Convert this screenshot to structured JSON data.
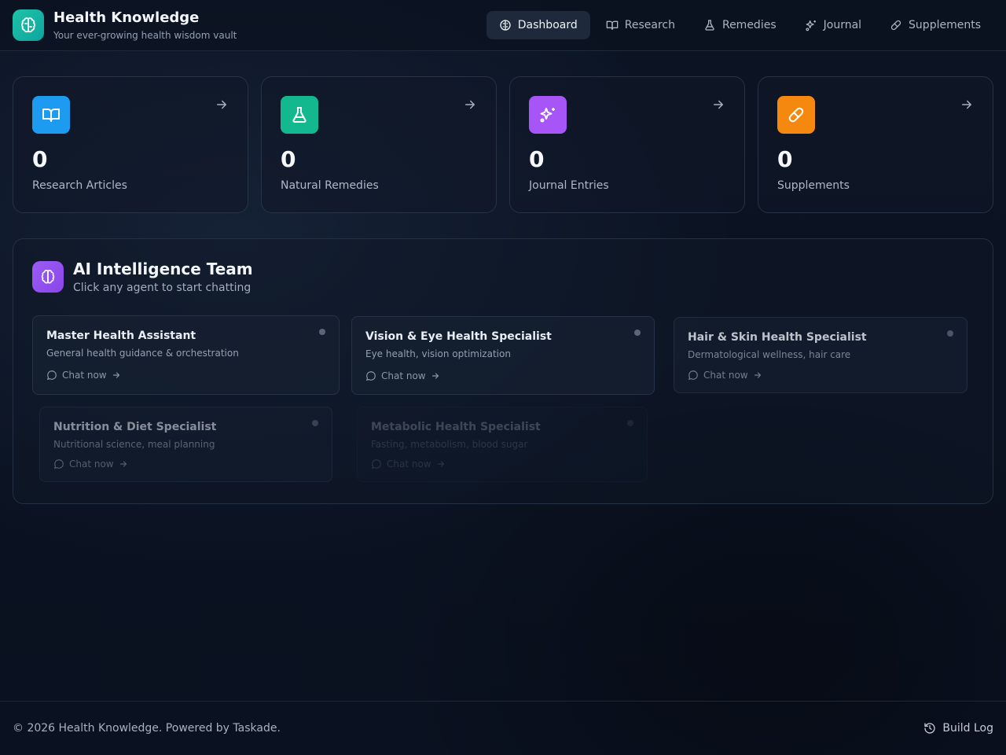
{
  "app": {
    "title": "Health Knowledge",
    "subtitle": "Your ever-growing health wisdom vault",
    "logo_icon": "brain-icon",
    "accent": "#14b8a6"
  },
  "nav": {
    "items": [
      {
        "label": "Dashboard",
        "icon": "brain-icon",
        "active": true
      },
      {
        "label": "Research",
        "icon": "book-open-icon",
        "active": false
      },
      {
        "label": "Remedies",
        "icon": "flask-icon",
        "active": false
      },
      {
        "label": "Journal",
        "icon": "sparkles-icon",
        "active": false
      },
      {
        "label": "Supplements",
        "icon": "pill-icon",
        "active": false
      }
    ]
  },
  "stats": [
    {
      "value": "0",
      "label": "Research Articles",
      "icon": "book-open-icon",
      "color": "#1d9bf0"
    },
    {
      "value": "0",
      "label": "Natural Remedies",
      "icon": "flask-icon",
      "color": "#14b88f"
    },
    {
      "value": "0",
      "label": "Journal Entries",
      "icon": "sparkles-icon",
      "color": "#a855f7"
    },
    {
      "value": "0",
      "label": "Supplements",
      "icon": "pill-icon",
      "color": "#f5890f"
    }
  ],
  "team": {
    "title": "AI Intelligence Team",
    "subtitle": "Click any agent to start chatting",
    "chat_label": "Chat now",
    "agents": [
      {
        "name": "Master Health Assistant",
        "desc": "General health guidance & orchestration"
      },
      {
        "name": "Vision & Eye Health Specialist",
        "desc": "Eye health, vision optimization"
      },
      {
        "name": "Hair & Skin Health Specialist",
        "desc": "Dermatological wellness, hair care"
      },
      {
        "name": "Nutrition & Diet Specialist",
        "desc": "Nutritional science, meal planning"
      },
      {
        "name": "Metabolic Health Specialist",
        "desc": "Fasting, metabolism, blood sugar"
      }
    ]
  },
  "footer": {
    "copyright": "© 2026 Health Knowledge. Powered by Taskade.",
    "build_log": "Build Log"
  }
}
